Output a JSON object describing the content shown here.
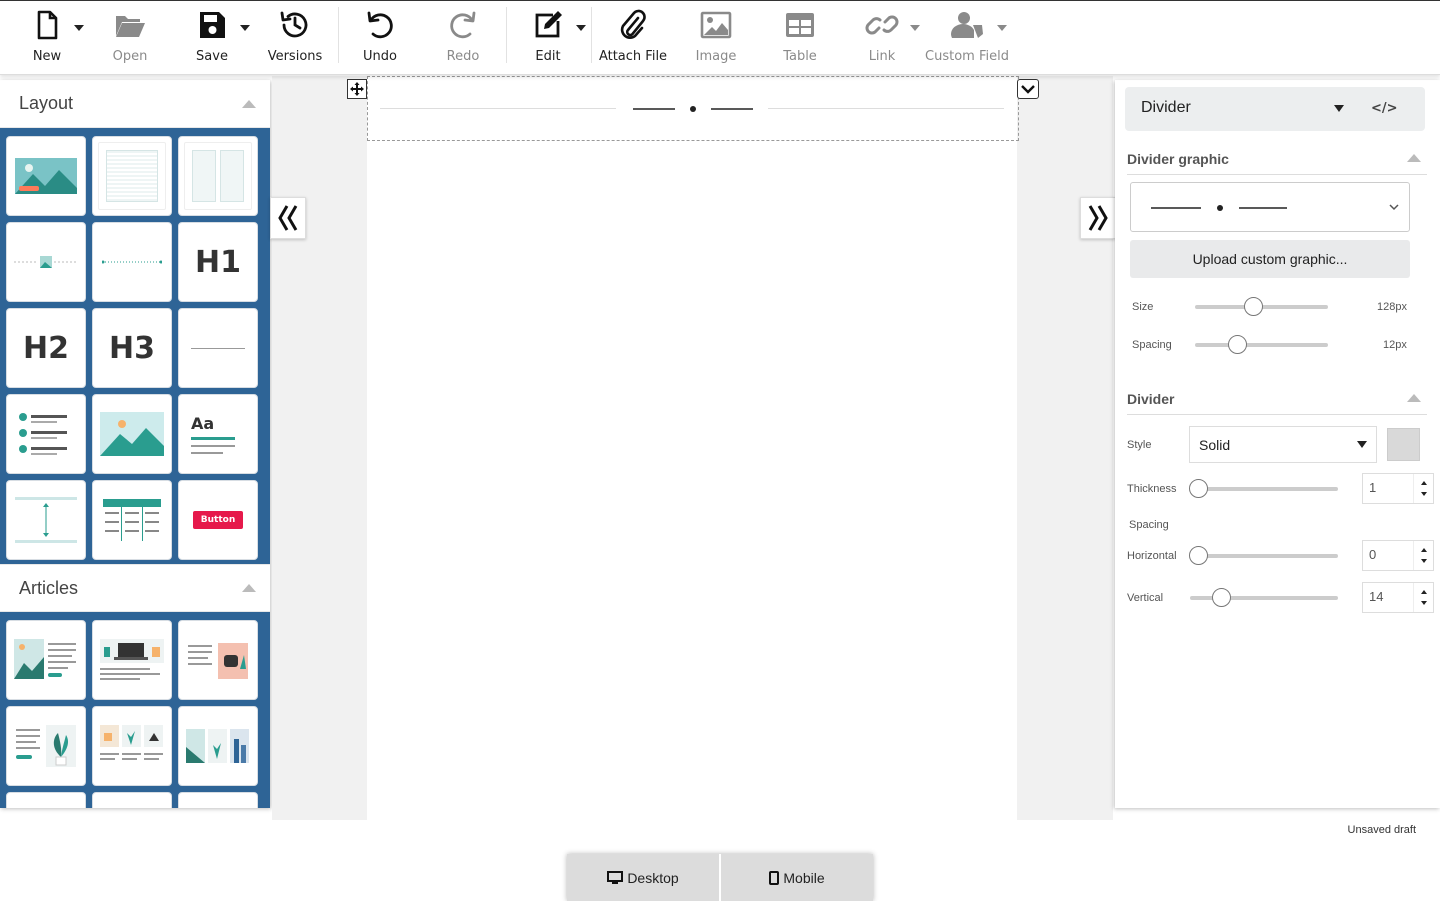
{
  "toolbar": {
    "new": "New",
    "open": "Open",
    "save": "Save",
    "versions": "Versions",
    "undo": "Undo",
    "redo": "Redo",
    "edit": "Edit",
    "attach_file": "Attach File",
    "image": "Image",
    "table": "Table",
    "link": "Link",
    "custom_field": "Custom Field"
  },
  "left_panel": {
    "layout_title": "Layout",
    "articles_title": "Articles",
    "heading_tiles": [
      "H1",
      "H2",
      "H3"
    ],
    "text_tile_label": "Aa",
    "button_tile_label": "Button"
  },
  "right_panel": {
    "block_selector": "Divider",
    "code_icon": "</>",
    "graphic_section": "Divider graphic",
    "upload_button": "Upload custom graphic...",
    "size_label": "Size",
    "size_value": "128px",
    "size_level": 0.43,
    "spacing_label": "Spacing",
    "spacing_value": "12px",
    "spacing_level": 0.29,
    "divider_section": "Divider",
    "style_label": "Style",
    "style_value": "Solid",
    "thickness_label": "Thickness",
    "thickness_value": "1",
    "spacing_group_label": "Spacing",
    "horizontal_label": "Horizontal",
    "horizontal_value": "0",
    "vertical_label": "Vertical",
    "vertical_value": "14",
    "style_color": "#d9d9d9"
  },
  "status": {
    "draft": "Unsaved draft"
  },
  "device": {
    "desktop": "Desktop",
    "mobile": "Mobile"
  },
  "colors": {
    "panel_blue": "#2e6496",
    "teal": "#2a9d8f",
    "button_red": "#e6194b"
  }
}
